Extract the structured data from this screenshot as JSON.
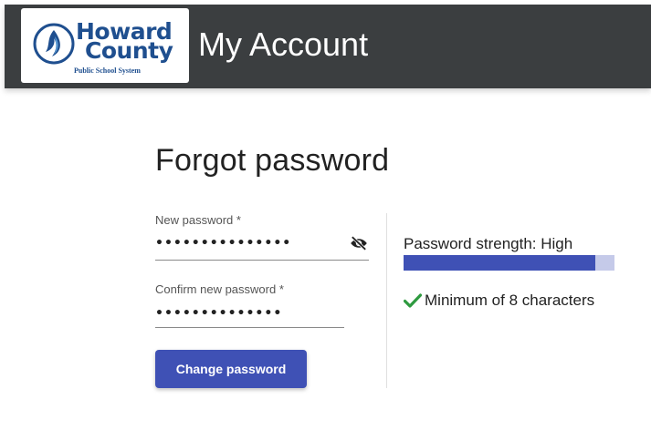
{
  "header": {
    "logo": {
      "line1": "Howard",
      "line2": "County",
      "tagline": "Public School System"
    },
    "title": "My Account"
  },
  "page": {
    "title": "Forgot password"
  },
  "form": {
    "new_password": {
      "label": "New password *",
      "value": "•••••••••••••••"
    },
    "confirm_password": {
      "label": "Confirm new password *",
      "value": "••••••••••••••"
    },
    "submit_label": "Change password"
  },
  "strength": {
    "label": "Password strength: High",
    "level": 0.91
  },
  "rules": [
    {
      "text": "Minimum of 8 characters",
      "met": true
    }
  ],
  "colors": {
    "header_bg": "#3b3e40",
    "primary": "#3f51b5",
    "track": "#c5cae9",
    "check": "#2e9a3f"
  },
  "icons": {
    "visibility_toggle": "eye-off-icon",
    "rule_met": "checkmark-icon"
  }
}
